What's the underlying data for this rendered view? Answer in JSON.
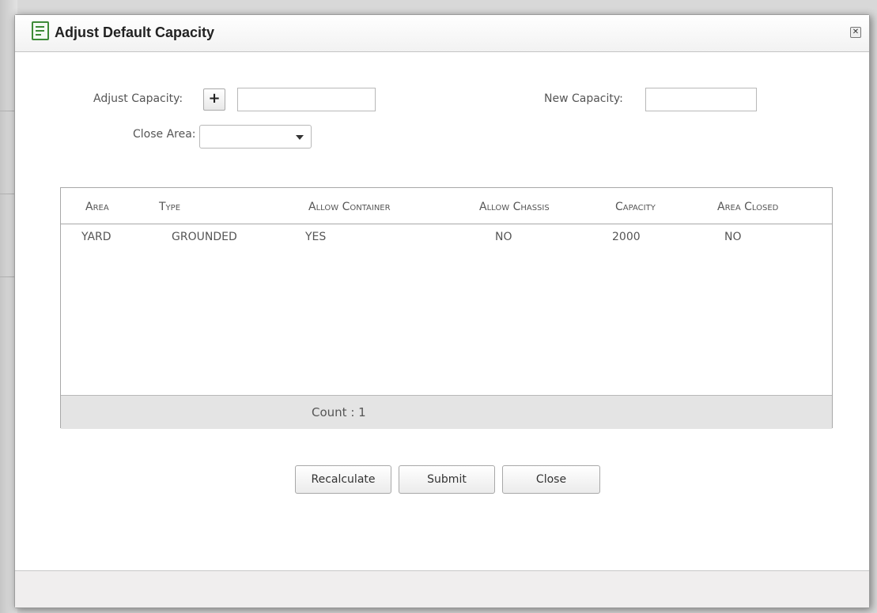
{
  "dialog": {
    "title": "Adjust Default Capacity",
    "close_icon": "close-x-icon"
  },
  "form": {
    "adjust_capacity_label": "Adjust Capacity:",
    "plus_symbol": "+",
    "adjust_capacity_value": "",
    "new_capacity_label": "New Capacity:",
    "new_capacity_value": "",
    "close_area_label": "Close Area:",
    "close_area_value": ""
  },
  "grid": {
    "columns": [
      "Area",
      "Type",
      "Allow Container",
      "Allow Chassis",
      "Capacity",
      "Area Closed"
    ],
    "rows": [
      [
        "YARD",
        "GROUNDED",
        "YES",
        "NO",
        "2000",
        "NO"
      ]
    ],
    "count_text": "Count : 1"
  },
  "buttons": {
    "recalculate": "Recalculate",
    "submit": "Submit",
    "close": "Close"
  },
  "colors": {
    "icon_green": "#3d8b37",
    "footer_gray": "#e4e4e4"
  }
}
